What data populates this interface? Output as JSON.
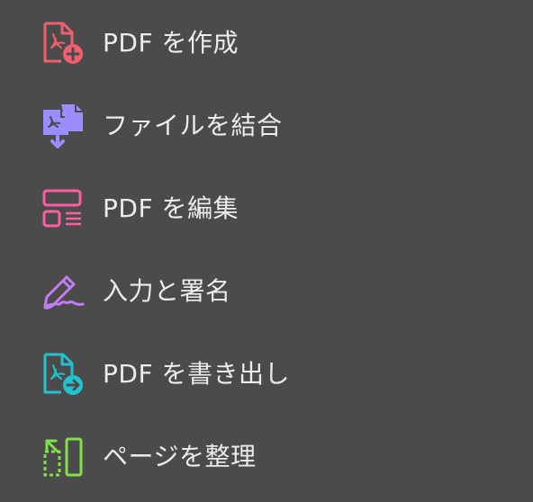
{
  "tools": [
    {
      "label": "PDF を作成",
      "icon": "create-pdf-icon",
      "color": "#f0606f"
    },
    {
      "label": "ファイルを結合",
      "icon": "combine-files-icon",
      "color": "#9b8cff"
    },
    {
      "label": "PDF を編集",
      "icon": "edit-pdf-icon",
      "color": "#ff5fa2"
    },
    {
      "label": "入力と署名",
      "icon": "fill-sign-icon",
      "color": "#c27cf5"
    },
    {
      "label": "PDF を書き出し",
      "icon": "export-pdf-icon",
      "color": "#22c3cf"
    },
    {
      "label": "ページを整理",
      "icon": "organize-pages-icon",
      "color": "#7fe04a"
    }
  ]
}
